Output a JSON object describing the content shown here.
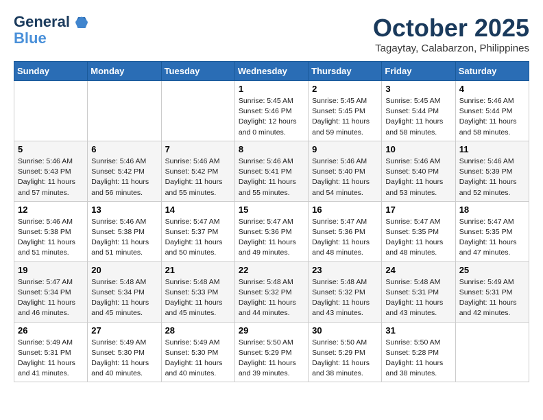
{
  "logo": {
    "line1": "General",
    "line2": "Blue"
  },
  "title": "October 2025",
  "location": "Tagaytay, Calabarzon, Philippines",
  "weekdays": [
    "Sunday",
    "Monday",
    "Tuesday",
    "Wednesday",
    "Thursday",
    "Friday",
    "Saturday"
  ],
  "weeks": [
    [
      {
        "day": "",
        "sunrise": "",
        "sunset": "",
        "daylight": ""
      },
      {
        "day": "",
        "sunrise": "",
        "sunset": "",
        "daylight": ""
      },
      {
        "day": "",
        "sunrise": "",
        "sunset": "",
        "daylight": ""
      },
      {
        "day": "1",
        "sunrise": "Sunrise: 5:45 AM",
        "sunset": "Sunset: 5:46 PM",
        "daylight": "Daylight: 12 hours and 0 minutes."
      },
      {
        "day": "2",
        "sunrise": "Sunrise: 5:45 AM",
        "sunset": "Sunset: 5:45 PM",
        "daylight": "Daylight: 11 hours and 59 minutes."
      },
      {
        "day": "3",
        "sunrise": "Sunrise: 5:45 AM",
        "sunset": "Sunset: 5:44 PM",
        "daylight": "Daylight: 11 hours and 58 minutes."
      },
      {
        "day": "4",
        "sunrise": "Sunrise: 5:46 AM",
        "sunset": "Sunset: 5:44 PM",
        "daylight": "Daylight: 11 hours and 58 minutes."
      }
    ],
    [
      {
        "day": "5",
        "sunrise": "Sunrise: 5:46 AM",
        "sunset": "Sunset: 5:43 PM",
        "daylight": "Daylight: 11 hours and 57 minutes."
      },
      {
        "day": "6",
        "sunrise": "Sunrise: 5:46 AM",
        "sunset": "Sunset: 5:42 PM",
        "daylight": "Daylight: 11 hours and 56 minutes."
      },
      {
        "day": "7",
        "sunrise": "Sunrise: 5:46 AM",
        "sunset": "Sunset: 5:42 PM",
        "daylight": "Daylight: 11 hours and 55 minutes."
      },
      {
        "day": "8",
        "sunrise": "Sunrise: 5:46 AM",
        "sunset": "Sunset: 5:41 PM",
        "daylight": "Daylight: 11 hours and 55 minutes."
      },
      {
        "day": "9",
        "sunrise": "Sunrise: 5:46 AM",
        "sunset": "Sunset: 5:40 PM",
        "daylight": "Daylight: 11 hours and 54 minutes."
      },
      {
        "day": "10",
        "sunrise": "Sunrise: 5:46 AM",
        "sunset": "Sunset: 5:40 PM",
        "daylight": "Daylight: 11 hours and 53 minutes."
      },
      {
        "day": "11",
        "sunrise": "Sunrise: 5:46 AM",
        "sunset": "Sunset: 5:39 PM",
        "daylight": "Daylight: 11 hours and 52 minutes."
      }
    ],
    [
      {
        "day": "12",
        "sunrise": "Sunrise: 5:46 AM",
        "sunset": "Sunset: 5:38 PM",
        "daylight": "Daylight: 11 hours and 51 minutes."
      },
      {
        "day": "13",
        "sunrise": "Sunrise: 5:46 AM",
        "sunset": "Sunset: 5:38 PM",
        "daylight": "Daylight: 11 hours and 51 minutes."
      },
      {
        "day": "14",
        "sunrise": "Sunrise: 5:47 AM",
        "sunset": "Sunset: 5:37 PM",
        "daylight": "Daylight: 11 hours and 50 minutes."
      },
      {
        "day": "15",
        "sunrise": "Sunrise: 5:47 AM",
        "sunset": "Sunset: 5:36 PM",
        "daylight": "Daylight: 11 hours and 49 minutes."
      },
      {
        "day": "16",
        "sunrise": "Sunrise: 5:47 AM",
        "sunset": "Sunset: 5:36 PM",
        "daylight": "Daylight: 11 hours and 48 minutes."
      },
      {
        "day": "17",
        "sunrise": "Sunrise: 5:47 AM",
        "sunset": "Sunset: 5:35 PM",
        "daylight": "Daylight: 11 hours and 48 minutes."
      },
      {
        "day": "18",
        "sunrise": "Sunrise: 5:47 AM",
        "sunset": "Sunset: 5:35 PM",
        "daylight": "Daylight: 11 hours and 47 minutes."
      }
    ],
    [
      {
        "day": "19",
        "sunrise": "Sunrise: 5:47 AM",
        "sunset": "Sunset: 5:34 PM",
        "daylight": "Daylight: 11 hours and 46 minutes."
      },
      {
        "day": "20",
        "sunrise": "Sunrise: 5:48 AM",
        "sunset": "Sunset: 5:34 PM",
        "daylight": "Daylight: 11 hours and 45 minutes."
      },
      {
        "day": "21",
        "sunrise": "Sunrise: 5:48 AM",
        "sunset": "Sunset: 5:33 PM",
        "daylight": "Daylight: 11 hours and 45 minutes."
      },
      {
        "day": "22",
        "sunrise": "Sunrise: 5:48 AM",
        "sunset": "Sunset: 5:32 PM",
        "daylight": "Daylight: 11 hours and 44 minutes."
      },
      {
        "day": "23",
        "sunrise": "Sunrise: 5:48 AM",
        "sunset": "Sunset: 5:32 PM",
        "daylight": "Daylight: 11 hours and 43 minutes."
      },
      {
        "day": "24",
        "sunrise": "Sunrise: 5:48 AM",
        "sunset": "Sunset: 5:31 PM",
        "daylight": "Daylight: 11 hours and 43 minutes."
      },
      {
        "day": "25",
        "sunrise": "Sunrise: 5:49 AM",
        "sunset": "Sunset: 5:31 PM",
        "daylight": "Daylight: 11 hours and 42 minutes."
      }
    ],
    [
      {
        "day": "26",
        "sunrise": "Sunrise: 5:49 AM",
        "sunset": "Sunset: 5:31 PM",
        "daylight": "Daylight: 11 hours and 41 minutes."
      },
      {
        "day": "27",
        "sunrise": "Sunrise: 5:49 AM",
        "sunset": "Sunset: 5:30 PM",
        "daylight": "Daylight: 11 hours and 40 minutes."
      },
      {
        "day": "28",
        "sunrise": "Sunrise: 5:49 AM",
        "sunset": "Sunset: 5:30 PM",
        "daylight": "Daylight: 11 hours and 40 minutes."
      },
      {
        "day": "29",
        "sunrise": "Sunrise: 5:50 AM",
        "sunset": "Sunset: 5:29 PM",
        "daylight": "Daylight: 11 hours and 39 minutes."
      },
      {
        "day": "30",
        "sunrise": "Sunrise: 5:50 AM",
        "sunset": "Sunset: 5:29 PM",
        "daylight": "Daylight: 11 hours and 38 minutes."
      },
      {
        "day": "31",
        "sunrise": "Sunrise: 5:50 AM",
        "sunset": "Sunset: 5:28 PM",
        "daylight": "Daylight: 11 hours and 38 minutes."
      },
      {
        "day": "",
        "sunrise": "",
        "sunset": "",
        "daylight": ""
      }
    ]
  ]
}
